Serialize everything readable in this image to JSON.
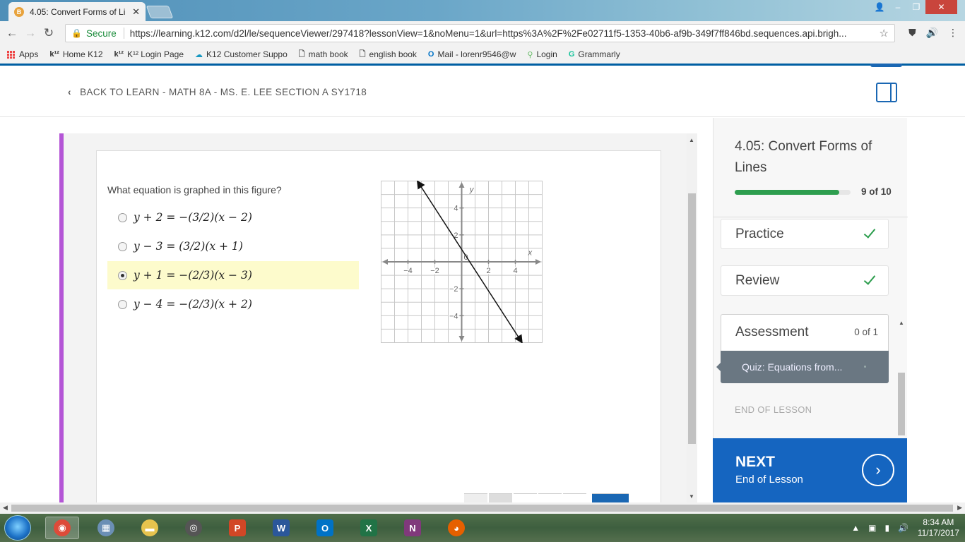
{
  "browser": {
    "tab_title": "4.05: Convert Forms of Li",
    "tab_close": "✕",
    "secure_label": "Secure",
    "url": "https://learning.k12.com/d2l/le/sequenceViewer/297418?lessonView=1&noMenu=1&url=https%3A%2F%2Fe02711f5-1353-40b6-af9b-349f7ff846bd.sequences.api.brigh..."
  },
  "bookmarks": [
    {
      "label": "Apps",
      "icon": "apps-grid-icon"
    },
    {
      "label": "Home  K12",
      "icon": "k12-icon"
    },
    {
      "label": "K¹² Login Page",
      "icon": "k12-icon"
    },
    {
      "label": "K12 Customer Suppo",
      "icon": "salesforce-icon"
    },
    {
      "label": "math book",
      "icon": "page-icon"
    },
    {
      "label": "english book",
      "icon": "page-icon"
    },
    {
      "label": "Mail - lorenr9546@w",
      "icon": "outlook-icon"
    },
    {
      "label": "Login",
      "icon": "login-icon"
    },
    {
      "label": "Grammarly",
      "icon": "grammarly-icon"
    }
  ],
  "header": {
    "back_label": "BACK TO LEARN - MATH 8A - MS. E. LEE SECTION A SY1718"
  },
  "question": {
    "prompt": "What equation is graphed in this figure?",
    "options": [
      {
        "label": "y + 2 = −(3/2)(x − 2)",
        "selected": false
      },
      {
        "label": "y − 3 = (3/2)(x + 1)",
        "selected": false
      },
      {
        "label": "y + 1 = −(2/3)(x − 3)",
        "selected": true
      },
      {
        "label": "y − 4 = −(2/3)(x + 2)",
        "selected": false
      }
    ]
  },
  "graph": {
    "x_axis_label": "x",
    "y_axis_label": "y",
    "x_ticks": [
      "−4",
      "−2",
      "2",
      "4"
    ],
    "y_ticks": [
      "4",
      "2",
      "−2",
      "−4"
    ],
    "origin_label": "0",
    "range": [
      -6,
      6
    ],
    "line_points": [
      [
        -3.3,
        6
      ],
      [
        4.5,
        -6
      ]
    ]
  },
  "side": {
    "lesson_title": "4.05: Convert Forms of Lines",
    "progress_text": "9 of 10",
    "progress_fraction": 0.9,
    "items": [
      {
        "label": "Practice",
        "done": true
      },
      {
        "label": "Review",
        "done": true
      }
    ],
    "assessment_label": "Assessment",
    "assessment_count": "0 of 1",
    "quiz_label": "Quiz: Equations from...",
    "end_label": "END OF LESSON",
    "next_title": "NEXT",
    "next_sub": "End of Lesson"
  },
  "taskbar": {
    "time": "8:34 AM",
    "date": "11/17/2017",
    "apps": [
      {
        "name": "chrome-icon",
        "color": "#dd4b39",
        "label": ""
      },
      {
        "name": "calculator-icon",
        "color": "#6b8fb5",
        "label": ""
      },
      {
        "name": "explorer-folder-icon",
        "color": "#e6c34e",
        "label": ""
      },
      {
        "name": "webcam-icon",
        "color": "#555555",
        "label": ""
      },
      {
        "name": "powerpoint-icon",
        "color": "#d24726",
        "label": "P"
      },
      {
        "name": "word-icon",
        "color": "#2b579a",
        "label": "W"
      },
      {
        "name": "outlook-icon",
        "color": "#0072c6",
        "label": "O"
      },
      {
        "name": "excel-icon",
        "color": "#217346",
        "label": "X"
      },
      {
        "name": "onenote-icon",
        "color": "#80397b",
        "label": "N"
      },
      {
        "name": "firefox-icon",
        "color": "#e66000",
        "label": ""
      }
    ]
  }
}
